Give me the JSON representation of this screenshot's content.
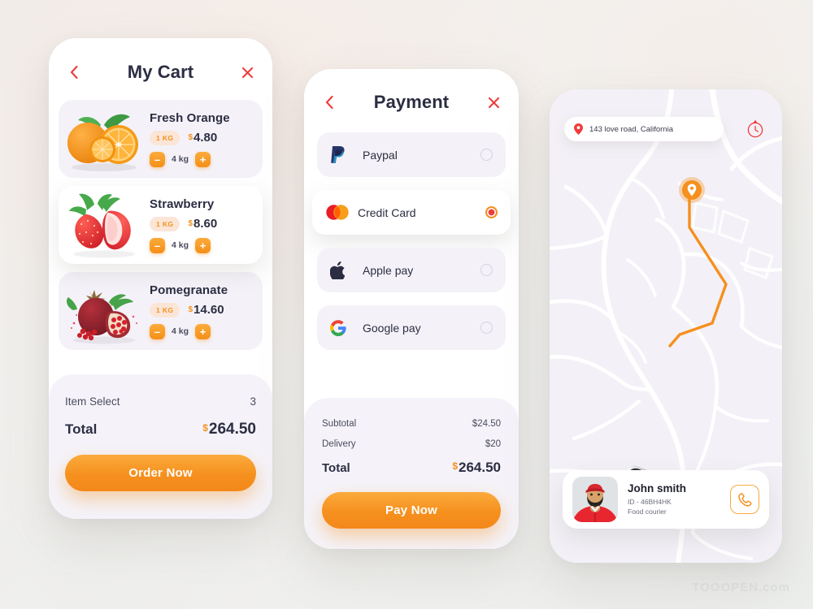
{
  "background": {
    "accent_orange": "#f5901e",
    "accent_red": "#ef3b3b",
    "ink": "#2b2d42"
  },
  "watermark": {
    "text": "TOOOPEN.com"
  },
  "cart_screen": {
    "title": "My Cart",
    "back_icon": "chevron-left-icon",
    "close_icon": "close-icon",
    "items": [
      {
        "name": "Fresh Orange",
        "weight_badge": "1 KG",
        "currency": "$",
        "price": "4.80",
        "qty": "4 kg",
        "minus": "–",
        "plus": "+",
        "image": "orange-image"
      },
      {
        "name": "Strawberry",
        "weight_badge": "1 KG",
        "currency": "$",
        "price": "8.60",
        "qty": "4 kg",
        "minus": "–",
        "plus": "+",
        "image": "strawberry-image"
      },
      {
        "name": "Pomegranate",
        "weight_badge": "1 KG",
        "currency": "$",
        "price": "14.60",
        "qty": "4 kg",
        "minus": "–",
        "plus": "+",
        "image": "pomegranate-image"
      }
    ],
    "summary": {
      "item_select_label": "Item Select",
      "item_select_value": "3",
      "total_label": "Total",
      "total_currency": "$",
      "total_value": "264.50"
    },
    "cta_label": "Order Now"
  },
  "payment_screen": {
    "title": "Payment",
    "back_icon": "chevron-left-icon",
    "close_icon": "close-icon",
    "methods": [
      {
        "label": "Paypal",
        "icon": "paypal-icon",
        "selected": false
      },
      {
        "label": "Credit Card",
        "icon": "mastercard-icon",
        "selected": true
      },
      {
        "label": "Apple pay",
        "icon": "apple-icon",
        "selected": false
      },
      {
        "label": "Google pay",
        "icon": "google-icon",
        "selected": false
      }
    ],
    "summary": {
      "subtotal_label": "Subtotal",
      "subtotal_value": "$24.50",
      "delivery_label": "Delivery",
      "delivery_value": "$20",
      "total_label": "Total",
      "total_currency": "$",
      "total_value": "264.50"
    },
    "cta_label": "Pay Now"
  },
  "map_screen": {
    "address": "143 love road, California",
    "address_pin_icon": "map-pin-icon",
    "compass_icon": "compass-icon",
    "destination_marker_icon": "destination-pin-icon",
    "vehicle_icon": "car-icon",
    "route_color": "#f5901e",
    "courier": {
      "name": "John smith",
      "id": "ID - 46BH4HK",
      "role": "Food courier",
      "avatar": "courier-avatar",
      "call_icon": "phone-icon"
    }
  }
}
